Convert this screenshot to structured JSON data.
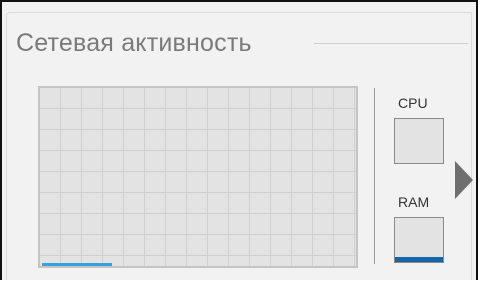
{
  "widget": {
    "title": "Сетевая активность"
  },
  "network_graph": {
    "current_level_fraction": 0.0,
    "history_fill_fraction": 0.22,
    "line_color": "#3aa0e0"
  },
  "meters": {
    "cpu": {
      "label": "CPU",
      "level_fraction": 0.0
    },
    "ram": {
      "label": "RAM",
      "level_fraction": 0.12,
      "fill_color": "#1565a8"
    }
  },
  "icons": {
    "expand": "chevron-right-icon"
  }
}
